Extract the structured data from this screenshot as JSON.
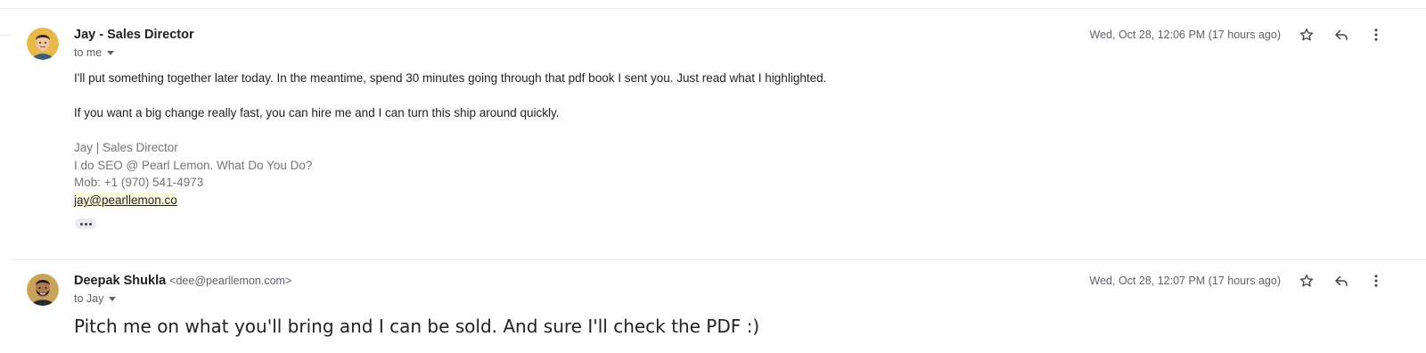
{
  "messages": [
    {
      "sender_name": "Jay - Sales Director",
      "sender_email": "",
      "recipient": "to me",
      "date": "Wed, Oct 28, 12:06 PM (17 hours ago)",
      "avatar": "avatar-illustration",
      "body": [
        "I'll put something together later today. In the meantime, spend 30 minutes going through that pdf book I sent you. Just read what I highlighted.",
        "If you want a big change really fast, you can hire me and I can turn this ship around quickly."
      ],
      "signature": {
        "name_line": "Jay | Sales Director",
        "tagline": "I do SEO @ Pearl Lemon. What Do You Do?",
        "mobile": "Mob: +1 (970) 541-4973",
        "email": "jay@pearllemon.co"
      },
      "actions": [
        "star-icon",
        "reply-icon",
        "more-vert-icon"
      ]
    },
    {
      "sender_name": "Deepak Shukla",
      "sender_email": "<dee@pearllemon.com>",
      "recipient": "to Jay",
      "date": "Wed, Oct 28, 12:07 PM (17 hours ago)",
      "avatar": "avatar-photo",
      "body": [
        "Pitch me on what you'll bring and I can be sold. And sure I'll check the PDF :)"
      ],
      "actions": [
        "star-icon",
        "reply-icon",
        "more-vert-icon"
      ]
    }
  ],
  "colors": {
    "text": "#202124",
    "secondary": "#5f6368",
    "signature": "#757575",
    "divider": "#e8eaed",
    "avatar_bg_1": "#e8b84a",
    "avatar_bg_2": "#c9a35a"
  }
}
